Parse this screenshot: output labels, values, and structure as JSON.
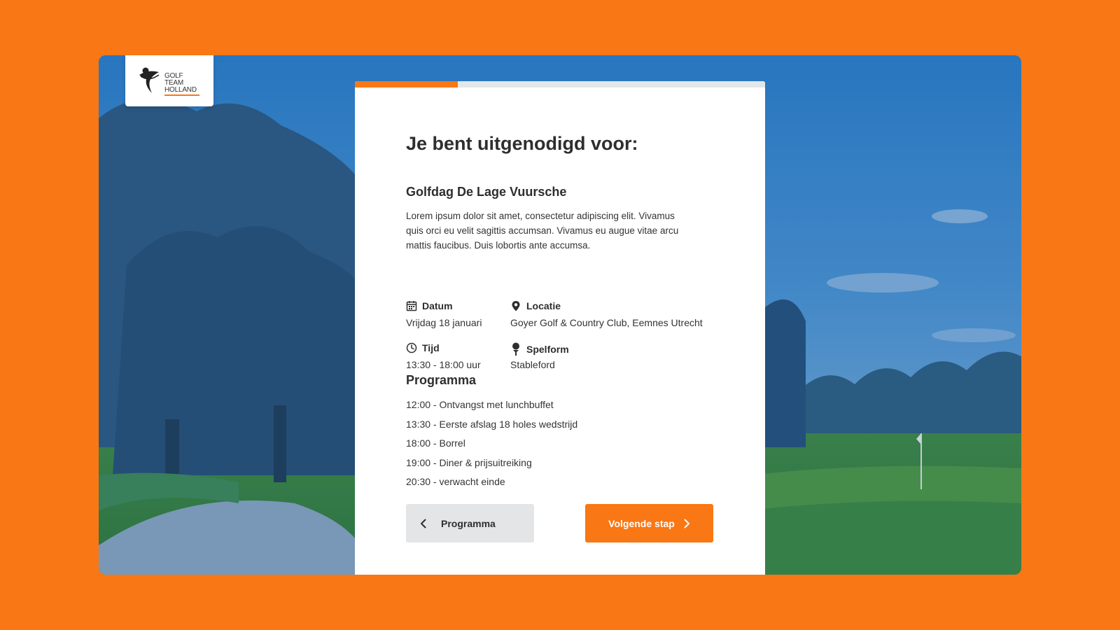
{
  "brand": {
    "logo_lines": [
      "GOLF",
      "TEAM",
      "HOLLAND"
    ],
    "accent_color": "#F97714"
  },
  "progress": {
    "value": 0.25
  },
  "card": {
    "title": "Je bent uitgenodigd voor:",
    "event_name": "Golfdag De Lage Vuursche",
    "description": "Lorem ipsum dolor sit amet, consectetur adipiscing elit. Vivamus quis orci eu velit sagittis accumsan. Vivamus eu augue vitae arcu mattis faucibus. Duis lobortis ante accumsa."
  },
  "details": {
    "datum": {
      "label": "Datum",
      "value": "Vrijdag 18 januari",
      "icon": "calendar-icon"
    },
    "locatie": {
      "label": "Locatie",
      "value": "Goyer Golf & Country Club, Eemnes Utrecht",
      "icon": "location-pin-icon"
    },
    "tijd": {
      "label": "Tijd",
      "value": "13:30 - 18:00 uur",
      "icon": "clock-icon"
    },
    "spelform": {
      "label": "Spelform",
      "value": "Stableford",
      "icon": "golf-tee-icon"
    }
  },
  "programma": {
    "title": "Programma",
    "items": [
      "12:00 - Ontvangst met lunchbuffet",
      "13:30 - Eerste afslag 18 holes wedstrijd",
      "18:00 - Borrel",
      "19:00 - Diner & prijsuitreiking",
      "20:30 - verwacht einde"
    ]
  },
  "buttons": {
    "back_label": "Programma",
    "next_label": "Volgende stap"
  }
}
